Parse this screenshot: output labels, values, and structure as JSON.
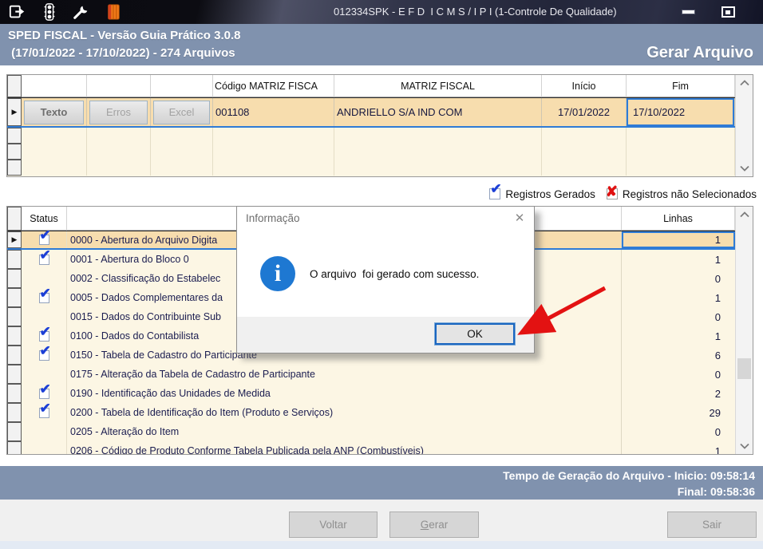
{
  "titlebar": {
    "title": "012334SPK - E F D  I C M S / I P I (1-Controle De Qualidade)",
    "icons": [
      "export-icon",
      "traffic-light-icon",
      "wrench-icon",
      "notebook-icon"
    ]
  },
  "header": {
    "line1": "SPED FISCAL - Versão Guia Prático 3.0.8",
    "line2": " (17/01/2022 - 17/10/2022) - 274 Arquivos",
    "action": "Gerar Arquivo"
  },
  "files_grid": {
    "buttons": {
      "texto": "Texto",
      "erros": "Erros",
      "excel": "Excel"
    },
    "columns": {
      "codigo": "Código MATRIZ FISCA",
      "matriz": "MATRIZ FISCAL",
      "inicio": "Início",
      "fim": "Fim"
    },
    "row": {
      "codigo": "001108",
      "matriz": "ANDRIELLO S/A IND COM",
      "inicio": "17/01/2022",
      "fim": "17/10/2022"
    }
  },
  "legend": {
    "gerados": "Registros Gerados",
    "nao_selecionados": "Registros não Selecionados"
  },
  "registros": {
    "status_header": "Status",
    "linhas_header": "Linhas",
    "rows": [
      {
        "label": "0000 - Abertura do Arquivo Digita",
        "linhas": "1",
        "checked": true,
        "selected": true
      },
      {
        "label": "0001 - Abertura do Bloco 0",
        "linhas": "1",
        "checked": true,
        "selected": false
      },
      {
        "label": "0002 - Classificação do Estabelec",
        "linhas": "0",
        "checked": false,
        "selected": false
      },
      {
        "label": "0005 - Dados Complementares da",
        "linhas": "1",
        "checked": true,
        "selected": false
      },
      {
        "label": "0015 - Dados do Contribuinte Sub",
        "linhas": "0",
        "checked": false,
        "selected": false
      },
      {
        "label": "0100 - Dados do Contabilista",
        "linhas": "1",
        "checked": true,
        "selected": false
      },
      {
        "label": "0150 - Tabela de Cadastro do Participante",
        "linhas": "6",
        "checked": true,
        "selected": false
      },
      {
        "label": "0175 - Alteração da Tabela de Cadastro de Participante",
        "linhas": "0",
        "checked": false,
        "selected": false
      },
      {
        "label": "0190 - Identificação das Unidades de Medida",
        "linhas": "2",
        "checked": true,
        "selected": false
      },
      {
        "label": "0200 - Tabela de Identificação do Item (Produto e Serviços)",
        "linhas": "29",
        "checked": true,
        "selected": false
      },
      {
        "label": "0205 - Alteração do Item",
        "linhas": "0",
        "checked": false,
        "selected": false
      },
      {
        "label": "0206 - Código de Produto Conforme Tabela Publicada pela ANP (Combustíveis)",
        "linhas": "1",
        "checked": false,
        "selected": false
      }
    ]
  },
  "dialog": {
    "title": "Informação",
    "message": "O arquivo  foi gerado com sucesso.",
    "ok": "OK",
    "close_icon": "✕",
    "info_glyph": "i"
  },
  "status_bar": {
    "line1": "Tempo de Geração do Arquivo - Inicio: 09:58:14",
    "line2": "Final: 09:58:36"
  },
  "footer": {
    "voltar": "Voltar",
    "gerar_initial": "G",
    "gerar_rest": "erar",
    "sair": "Sair"
  },
  "colors": {
    "band_slate": "#8092ae",
    "selected_row": "#f7ddae",
    "grid_bg": "#fcf6e4",
    "check_blue": "#1c3fd6",
    "x_red": "#e01111",
    "focus_blue": "#2e7bd6",
    "arrow_red": "#e31212",
    "info_blue": "#1e78d2"
  }
}
